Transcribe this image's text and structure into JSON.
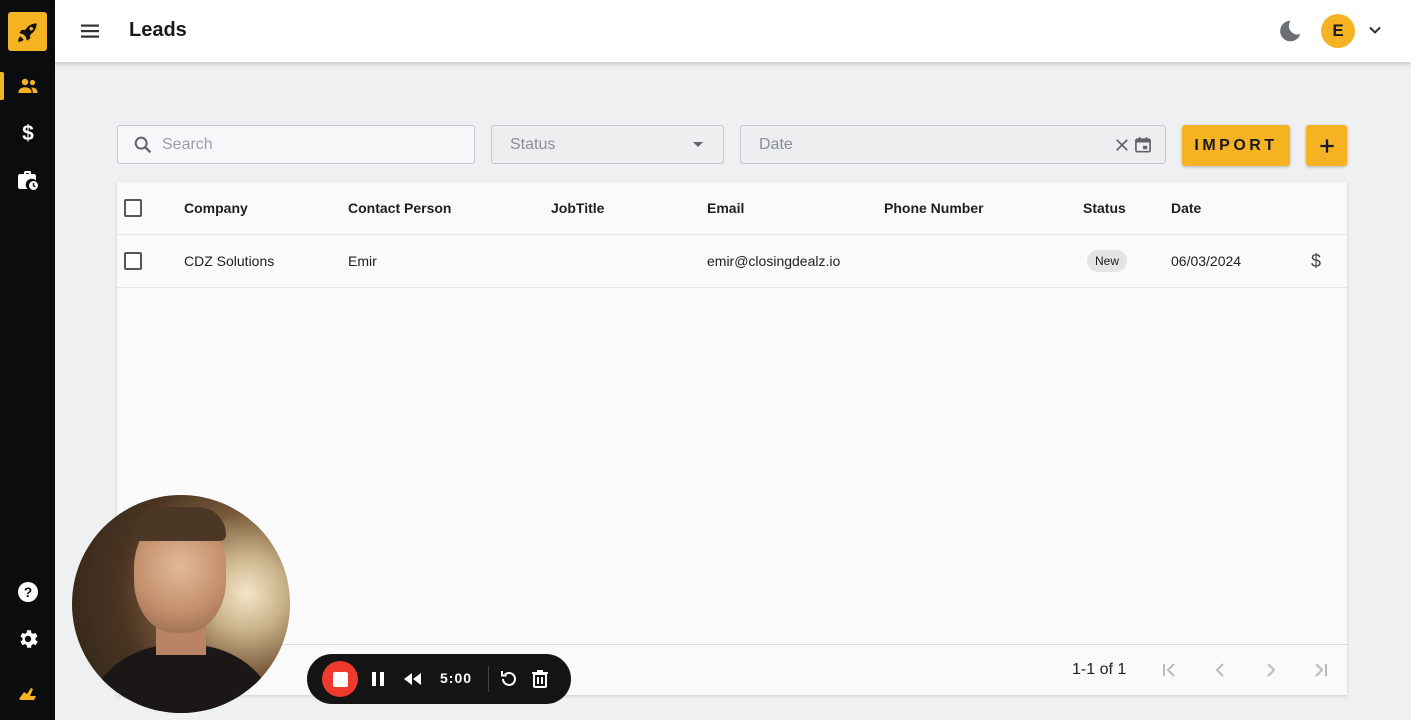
{
  "colors": {
    "accent": "#f5b323",
    "sidebar_bg": "#0b0c0e",
    "record_red": "#ee3a2e"
  },
  "sidebar": {
    "logo_icon": "rocket-icon",
    "items": [
      {
        "name": "leads",
        "icon": "people-icon",
        "active": true
      },
      {
        "name": "deals",
        "icon": "dollar-icon",
        "active": false
      },
      {
        "name": "jobs",
        "icon": "briefcase-clock-icon",
        "active": false
      }
    ],
    "bottom_items": [
      {
        "name": "help",
        "icon": "help-icon"
      },
      {
        "name": "settings",
        "icon": "gear-icon"
      },
      {
        "name": "brand",
        "icon": "hand-logo-icon"
      }
    ]
  },
  "header": {
    "title": "Leads",
    "avatar_initial": "E"
  },
  "filters": {
    "search_placeholder": "Search",
    "status_placeholder": "Status",
    "date_placeholder": "Date",
    "import_label": "IMPORT"
  },
  "table": {
    "columns": [
      "Company",
      "Contact Person",
      "JobTitle",
      "Email",
      "Phone Number",
      "Status",
      "Date"
    ],
    "rows": [
      {
        "company": "CDZ Solutions",
        "contact": "Emir",
        "job_title": "",
        "email": "emir@closingdealz.io",
        "phone": "",
        "status": "New",
        "date": "06/03/2024",
        "action_symbol": "$"
      }
    ],
    "pagination": "1-1 of 1"
  },
  "recorder": {
    "time": "5:00"
  }
}
